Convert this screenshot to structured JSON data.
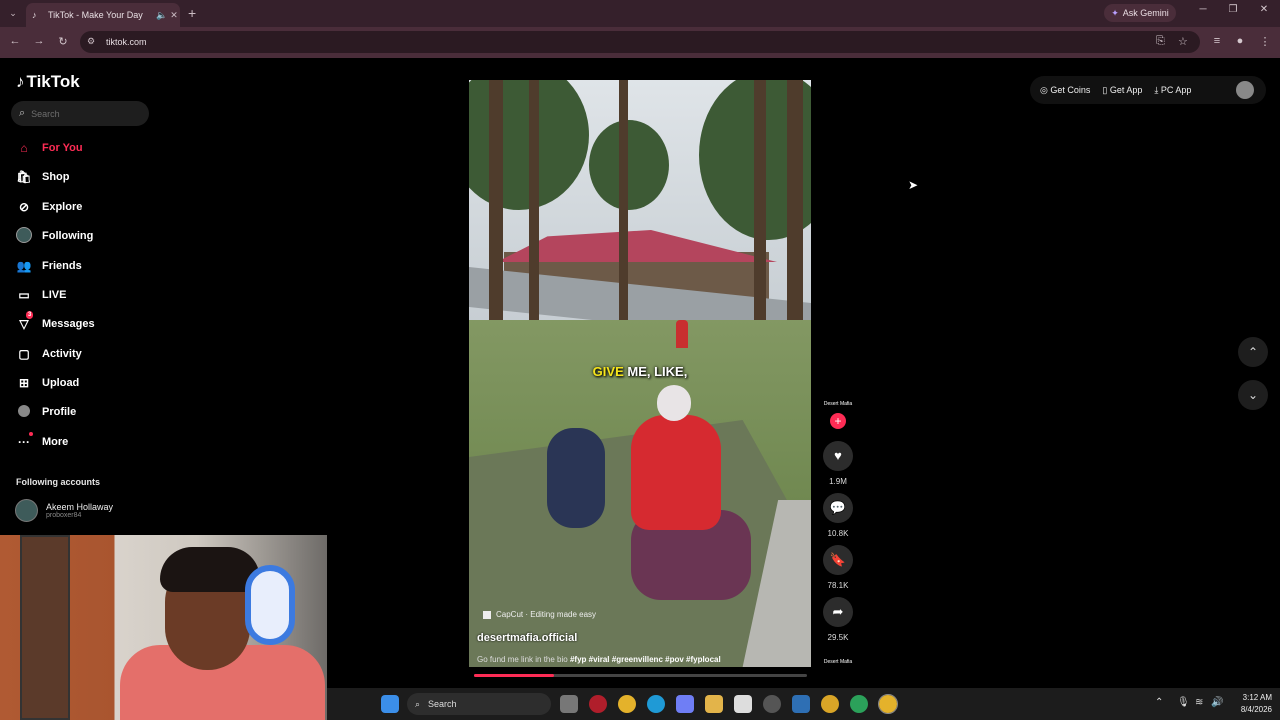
{
  "browser": {
    "tab_title": "TikTok - Make Your Day",
    "url": "tiktok.com",
    "ask_gemini": "Ask Gemini"
  },
  "tiktok": {
    "logo": "TikTok",
    "search_placeholder": "Search",
    "nav": [
      {
        "label": "For You",
        "icon": "home-icon",
        "active": true
      },
      {
        "label": "Shop",
        "icon": "shop-icon"
      },
      {
        "label": "Explore",
        "icon": "compass-icon"
      },
      {
        "label": "Following",
        "icon": "following-avatar-icon"
      },
      {
        "label": "Friends",
        "icon": "friends-icon"
      },
      {
        "label": "LIVE",
        "icon": "live-icon"
      },
      {
        "label": "Messages",
        "icon": "messages-icon",
        "badge": "3"
      },
      {
        "label": "Activity",
        "icon": "activity-icon"
      },
      {
        "label": "Upload",
        "icon": "upload-icon"
      },
      {
        "label": "Profile",
        "icon": "profile-icon"
      },
      {
        "label": "More",
        "icon": "more-icon"
      }
    ],
    "following_header": "Following accounts",
    "following_accounts": [
      {
        "name": "Akeem Hollaway",
        "handle": "proboxer84"
      }
    ],
    "top_actions": {
      "coins": "Get Coins",
      "app": "Get App",
      "pc_app": "PC App"
    }
  },
  "video": {
    "caption_highlight": "GIVE",
    "caption_rest": "ME, LIKE,",
    "capcut": "CapCut · Editing made easy",
    "username": "desertmafia.official",
    "description": "Go fund me link in the bio",
    "hashtags": "#fyp #viral #greenvillenc #pov #fyplocal",
    "progress": 0.24,
    "creator_label": "Desert Mafia",
    "likes": "1.9M",
    "comments": "10.8K",
    "saves": "78.1K",
    "shares": "29.5K"
  },
  "taskbar": {
    "search": "Search",
    "time": "3:12 AM",
    "date": "8/4/2026"
  },
  "colors": {
    "accent": "#fe2c55",
    "caption_highlight": "#f6e51b"
  }
}
